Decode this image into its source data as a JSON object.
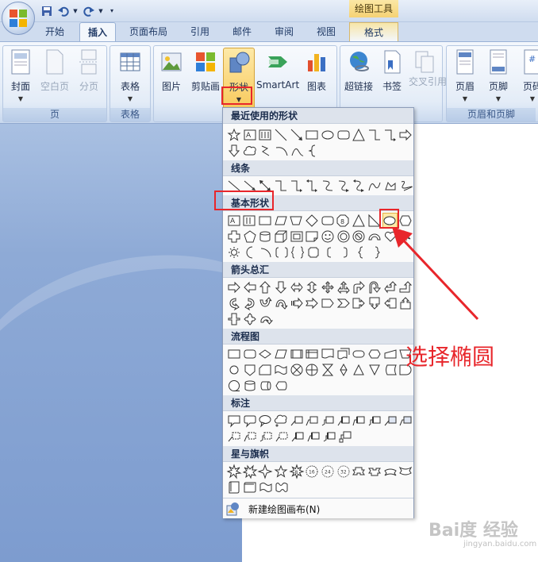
{
  "titlebar": {
    "context_tab": "绘图工具"
  },
  "tabs": [
    {
      "label": "开始"
    },
    {
      "label": "插入"
    },
    {
      "label": "页面布局"
    },
    {
      "label": "引用"
    },
    {
      "label": "邮件"
    },
    {
      "label": "审阅"
    },
    {
      "label": "视图"
    },
    {
      "label": "格式"
    }
  ],
  "ribbon": {
    "groups": {
      "page": "页",
      "table": "表格",
      "header_footer": "页眉和页脚"
    },
    "buttons": {
      "cover": "封面",
      "blank": "空白页",
      "pagebreak": "分页",
      "table": "表格",
      "picture": "图片",
      "clipart": "剪贴画",
      "shapes": "形状",
      "smartart": "SmartArt",
      "chart": "图表",
      "hyperlink": "超链接",
      "bookmark": "书签",
      "crossref": "交叉引用",
      "header": "页眉",
      "footer": "页脚",
      "pagenum": "页码"
    }
  },
  "menu": {
    "sections": {
      "recent": "最近使用的形状",
      "lines": "线条",
      "basic": "基本形状",
      "arrows": "箭头总汇",
      "flowchart": "流程图",
      "callouts": "标注",
      "stars": "星与旗帜"
    },
    "new_canvas": "新建绘图画布(N)"
  },
  "annotation": "选择椭圆",
  "watermark": {
    "main": "Bai度 经验",
    "sub": "jingyan.baidu.com"
  },
  "colors": {
    "highlight": "#e8262b",
    "ribbon": "#dfe9f6"
  }
}
